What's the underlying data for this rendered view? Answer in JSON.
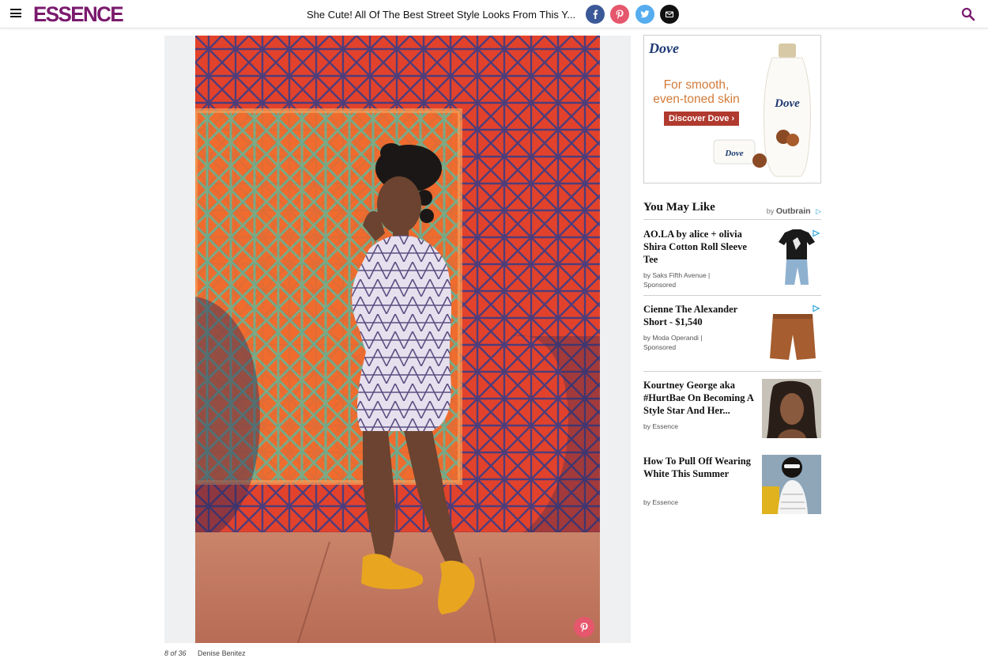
{
  "header": {
    "logo": "ESSENCE",
    "headline": "She Cute! All Of The Best Street Style Looks From This Y...",
    "share": [
      "facebook-icon",
      "pinterest-icon",
      "twitter-icon",
      "email-icon"
    ]
  },
  "gallery": {
    "counter": "8 of 36",
    "credit": "Denise Benitez"
  },
  "ad": {
    "brand": "Dove",
    "tagline": "For smooth, even-toned skin",
    "cta": "Discover Dove ›"
  },
  "recommendations": {
    "title": "You May Like",
    "by": "by",
    "provider": "Outbrain",
    "items": [
      {
        "title": "AO.LA by alice + olivia Shira Cotton Roll Sleeve Tee",
        "source": "by Saks Fifth Avenue | Sponsored"
      },
      {
        "title": "Cienne The Alexander Short - $1,540",
        "source": "by Moda Operandi | Sponsored"
      },
      {
        "title": "Kourtney George aka #HurtBae On Becoming A Style Star And Her...",
        "source": "by Essence"
      },
      {
        "title": "How To Pull Off Wearing White This Summer",
        "source": "by Essence"
      }
    ]
  },
  "colors": {
    "brand": "#7a1a6e",
    "facebook": "#3b5998",
    "pinterest": "#e5576c",
    "twitter": "#55acee",
    "ad_cta": "#b03a2e"
  }
}
